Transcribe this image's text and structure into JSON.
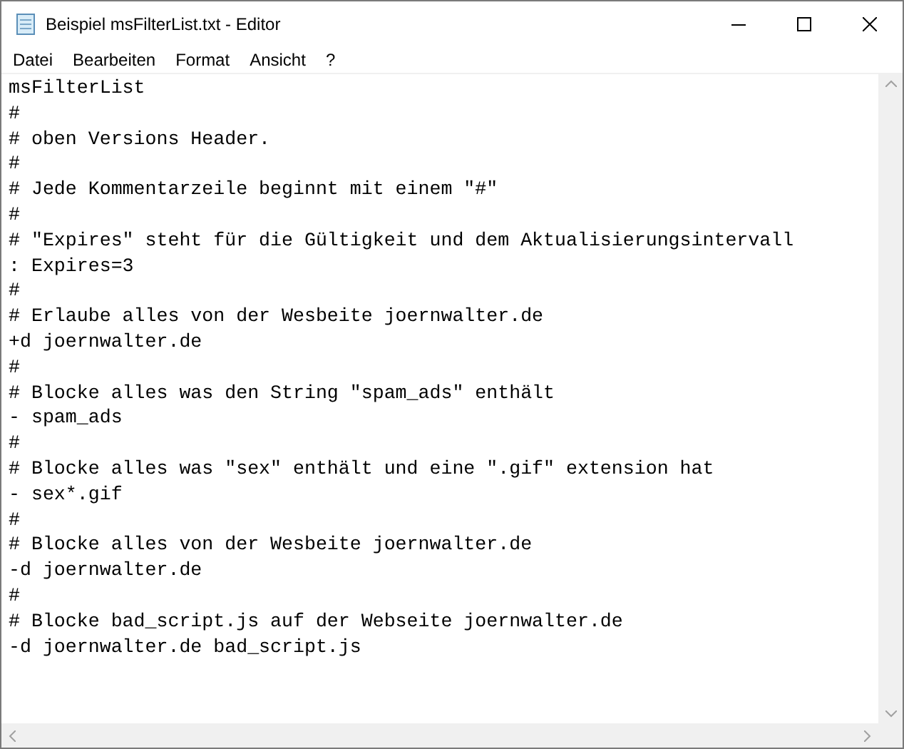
{
  "window": {
    "title": "Beispiel msFilterList.txt - Editor"
  },
  "menu": [
    "Datei",
    "Bearbeiten",
    "Format",
    "Ansicht",
    "?"
  ],
  "lines": [
    "msFilterList",
    "#",
    "# oben Versions Header.",
    "#",
    "# Jede Kommentarzeile beginnt mit einem \"#\"",
    "#",
    "# \"Expires\" steht für die Gültigkeit und dem Aktualisierungsintervall",
    ": Expires=3",
    "#",
    "# Erlaube alles von der Wesbeite joernwalter.de",
    "+d joernwalter.de",
    "#",
    "# Blocke alles was den String \"spam_ads\" enthält",
    "- spam_ads",
    "#",
    "# Blocke alles was \"sex\" enthält und eine \".gif\" extension hat",
    "- sex*.gif",
    "#",
    "# Blocke alles von der Wesbeite joernwalter.de",
    "-d joernwalter.de",
    "#",
    "# Blocke bad_script.js auf der Webseite joernwalter.de",
    "-d joernwalter.de bad_script.js"
  ]
}
